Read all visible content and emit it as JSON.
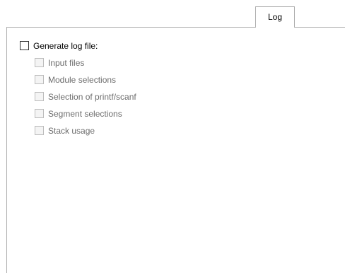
{
  "tabs": [
    {
      "label": "Log",
      "selected": true
    }
  ],
  "log": {
    "generate_label": "Generate log file:",
    "generate_checked": false,
    "options": [
      {
        "label": "Input files",
        "checked": false,
        "enabled": false
      },
      {
        "label": "Module selections",
        "checked": false,
        "enabled": false
      },
      {
        "label": "Selection of printf/scanf",
        "checked": false,
        "enabled": false
      },
      {
        "label": "Segment selections",
        "checked": false,
        "enabled": false
      },
      {
        "label": "Stack usage",
        "checked": false,
        "enabled": false
      }
    ]
  },
  "colors": {
    "border": "#adadad",
    "disabled_text": "#6d6d6d",
    "text": "#000000"
  }
}
